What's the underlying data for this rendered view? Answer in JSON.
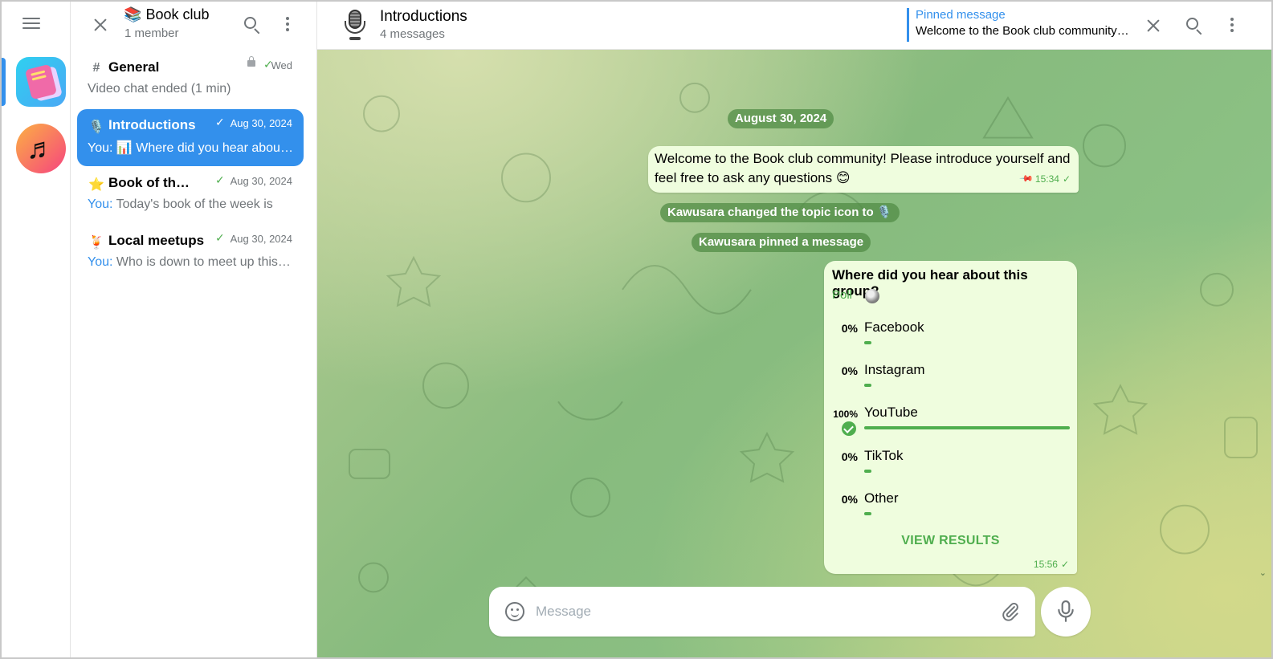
{
  "group": {
    "title": "Book club",
    "title_emoji": "📚",
    "subtitle": "1 member"
  },
  "topics": [
    {
      "icon": "#",
      "name": "General",
      "date": "Wed",
      "preview_you": "",
      "preview": "Video chat ended (1 min)",
      "locked": true
    },
    {
      "icon": "🎙️",
      "name": "Introductions",
      "date": "Aug 30, 2024",
      "preview_you": "You:",
      "preview": "📊 Where did you hear about this group?",
      "locked": false
    },
    {
      "icon": "⭐",
      "name": "Book of the week",
      "date": "Aug 30, 2024",
      "preview_you": "You:",
      "preview": "Today's book of the week is",
      "locked": false
    },
    {
      "icon": "🍹",
      "name": "Local meetups",
      "date": "Aug 30, 2024",
      "preview_you": "You:",
      "preview": "Who is down to meet up this weekend?",
      "locked": false
    }
  ],
  "chat": {
    "title": "Introductions",
    "subtitle": "4 messages",
    "pinned_label": "Pinned message",
    "pinned_text": "Welcome to the Book club community! Please introduce yourself",
    "date_chip": "August 30, 2024",
    "message1": {
      "text": "Welcome to the Book club community! Please introduce yourself and feel free to ask any questions 😊",
      "time": "15:34"
    },
    "service1": "Kawusara changed the topic icon to 🎙️",
    "service2": "Kawusara pinned a message",
    "poll": {
      "question": "Where did you hear about this group?",
      "type_label": "Poll",
      "options": [
        {
          "pct": "0%",
          "label": "Facebook",
          "fill": 0,
          "chosen": false
        },
        {
          "pct": "0%",
          "label": "Instagram",
          "fill": 0,
          "chosen": false
        },
        {
          "pct": "100%",
          "label": "YouTube",
          "fill": 100,
          "chosen": true
        },
        {
          "pct": "0%",
          "label": "TikTok",
          "fill": 0,
          "chosen": false
        },
        {
          "pct": "0%",
          "label": "Other",
          "fill": 0,
          "chosen": false
        }
      ],
      "view_results": "VIEW RESULTS",
      "time": "15:56"
    }
  },
  "composer": {
    "placeholder": "Message"
  },
  "colors": {
    "accent": "#3390ec",
    "outgoing_green": "#4fae4e",
    "bubble": "#effdde"
  }
}
